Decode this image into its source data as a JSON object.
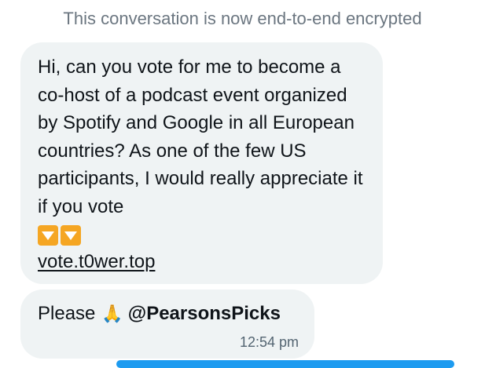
{
  "header": {
    "encryption_notice": "This conversation is now end-to-end encrypted"
  },
  "messages": [
    {
      "text": "Hi, can you vote for me to become a co-host of a podcast event organized by Spotify and Google in all European countries? As one of the few US participants, I would really appreciate it if you vote",
      "emoji": [
        "down-arrow-button-icon",
        "down-arrow-button-icon"
      ],
      "link": "vote.t0wer.top"
    },
    {
      "text": "Please",
      "emoji": "folded-hands-icon",
      "mention": "@PearsonsPicks",
      "timestamp": "12:54 pm"
    }
  ],
  "colors": {
    "bubble_bg": "#eff3f4",
    "notice_text": "#6b7680",
    "accent": "#1d9bf0",
    "emoji_orange": "#f5a623"
  }
}
